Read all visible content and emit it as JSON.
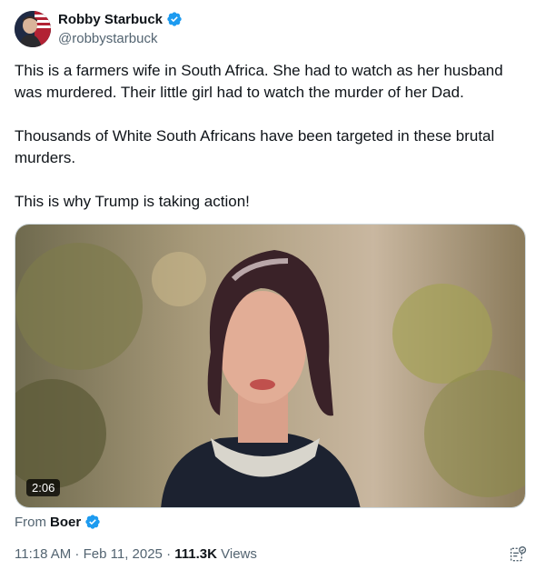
{
  "author": {
    "name": "Robby Starbuck",
    "handle": "@robbystarbuck",
    "verified_color": "#1d9bf0"
  },
  "post": {
    "paragraphs": [
      "This is a farmers wife in South Africa. She had to watch as her husband was murdered. Their little girl had to watch the murder of her Dad.",
      "Thousands of White South Africans have been targeted in these brutal murders.",
      "This is why Trump is taking action!"
    ]
  },
  "media": {
    "duration": "2:06"
  },
  "source": {
    "prefix": "From",
    "name": "Boer"
  },
  "meta": {
    "time": "11:18 AM",
    "sep1": " · ",
    "date": "Feb 11, 2025",
    "sep2": " · ",
    "views_count": "111.3K",
    "views_label": " Views"
  },
  "icons": {
    "verified": "verified-badge-icon",
    "grok": "grok-explain-icon"
  }
}
